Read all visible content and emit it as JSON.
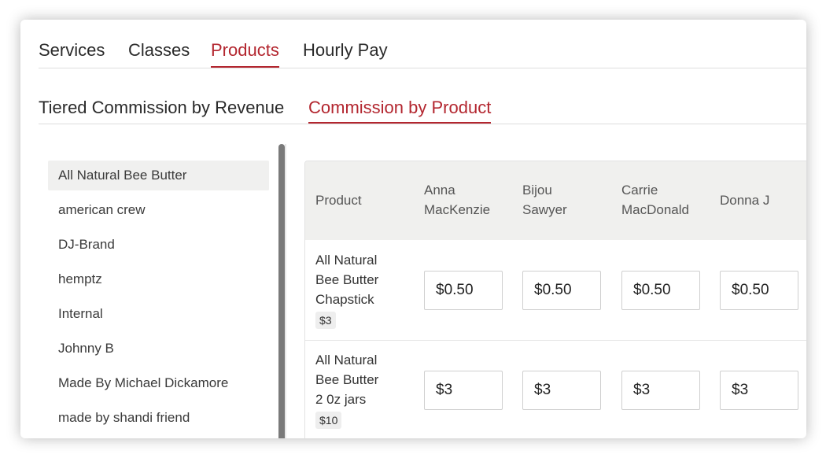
{
  "primary_tabs": [
    {
      "label": "Services"
    },
    {
      "label": "Classes"
    },
    {
      "label": "Products",
      "active": true
    },
    {
      "label": "Hourly Pay"
    }
  ],
  "secondary_tabs": [
    {
      "label": "Tiered Commission by Revenue"
    },
    {
      "label": "Commission by Product",
      "active": true
    }
  ],
  "brands": [
    {
      "label": "All Natural Bee Butter",
      "selected": true
    },
    {
      "label": "american crew"
    },
    {
      "label": "DJ-Brand"
    },
    {
      "label": "hemptz"
    },
    {
      "label": "Internal"
    },
    {
      "label": "Johnny B"
    },
    {
      "label": "Made By Michael Dickamore"
    },
    {
      "label": "made by shandi friend"
    }
  ],
  "table": {
    "product_header": "Product",
    "staff": [
      {
        "line1": "Anna",
        "line2": "MacKenzie"
      },
      {
        "line1": "Bijou",
        "line2": "Sawyer"
      },
      {
        "line1": "Carrie",
        "line2": "MacDonald"
      },
      {
        "line1": "Donna J",
        "line2": ""
      }
    ],
    "rows": [
      {
        "name_lines": [
          "All Natural",
          "Bee Butter",
          "Chapstick"
        ],
        "price": "$3",
        "commissions": [
          "$0.50",
          "$0.50",
          "$0.50",
          "$0.50"
        ]
      },
      {
        "name_lines": [
          "All Natural",
          "Bee Butter",
          "2 0z jars"
        ],
        "price": "$10",
        "commissions": [
          "$3",
          "$3",
          "$3",
          "$3"
        ]
      }
    ]
  },
  "colors": {
    "accent": "#b3262f",
    "header_bg": "#f0f0ee",
    "selected_bg": "#f0f0ef"
  }
}
